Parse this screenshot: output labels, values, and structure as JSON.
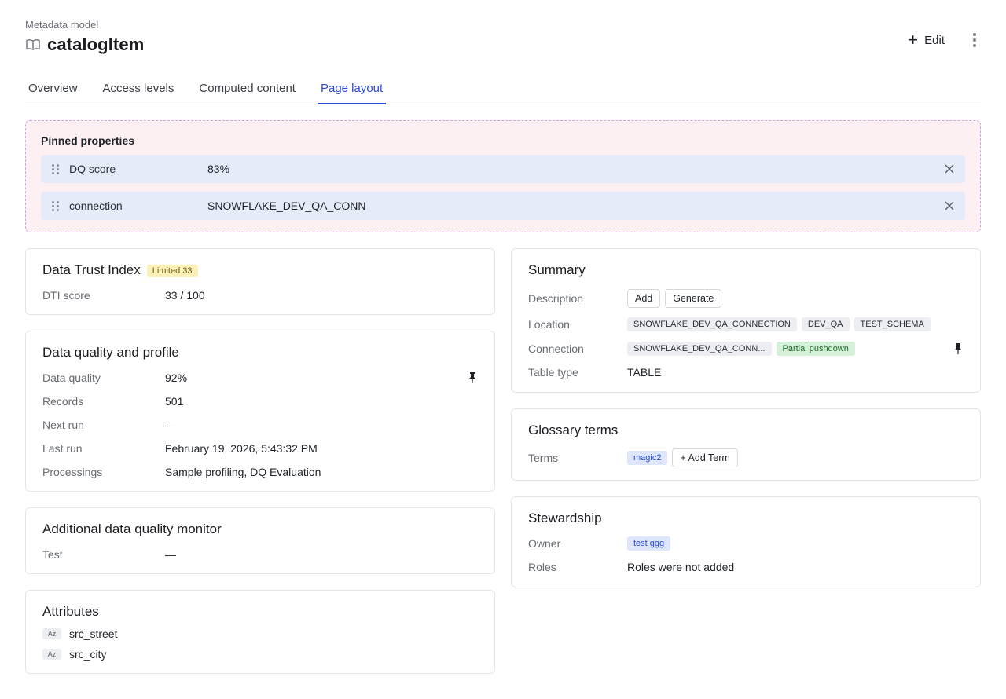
{
  "header": {
    "eyebrow": "Metadata model",
    "title": "catalogItem",
    "edit_label": "Edit"
  },
  "tabs": [
    {
      "label": "Overview"
    },
    {
      "label": "Access levels"
    },
    {
      "label": "Computed content"
    },
    {
      "label": "Page layout",
      "active": true
    }
  ],
  "pinned": {
    "title": "Pinned properties",
    "items": [
      {
        "key": "DQ score",
        "value": "83%"
      },
      {
        "key": "connection",
        "value": "SNOWFLAKE_DEV_QA_CONN"
      }
    ]
  },
  "dti": {
    "title": "Data Trust Index",
    "badge": "Limited 33",
    "rows": [
      {
        "key": "DTI score",
        "value": "33 / 100"
      }
    ]
  },
  "dq": {
    "title": "Data quality and profile",
    "rows": [
      {
        "key": "Data quality",
        "value": "92%"
      },
      {
        "key": "Records",
        "value": "501"
      },
      {
        "key": "Next run",
        "value": "—"
      },
      {
        "key": "Last run",
        "value": "February 19, 2026, 5:43:32 PM"
      },
      {
        "key": "Processings",
        "value": "Sample profiling, DQ Evaluation"
      }
    ]
  },
  "monitor": {
    "title": "Additional data quality monitor",
    "rows": [
      {
        "key": "Test",
        "value": "—"
      }
    ]
  },
  "attributes": {
    "title": "Attributes",
    "type_label": "Az",
    "items": [
      "src_street",
      "src_city"
    ]
  },
  "summary": {
    "title": "Summary",
    "description_label": "Description",
    "add_label": "Add",
    "generate_label": "Generate",
    "location_label": "Location",
    "location_chips": [
      "SNOWFLAKE_DEV_QA_CONNECTION",
      "DEV_QA",
      "TEST_SCHEMA"
    ],
    "connection_label": "Connection",
    "connection_chip": "SNOWFLAKE_DEV_QA_CONN...",
    "pushdown_chip": "Partial pushdown",
    "table_type_label": "Table type",
    "table_type_value": "TABLE"
  },
  "glossary": {
    "title": "Glossary terms",
    "terms_label": "Terms",
    "term_chip": "magic2",
    "add_term_label": "+ Add Term"
  },
  "stewardship": {
    "title": "Stewardship",
    "owner_label": "Owner",
    "owner_chip": "test ggg",
    "roles_label": "Roles",
    "roles_value": "Roles were not added"
  },
  "colors": {
    "accent": "#2a4bd7",
    "pinned_bg": "#fdf0f3",
    "pinned_row_bg": "#e6ebfa",
    "limited_badge_bg": "#fbf1b8",
    "pushdown_chip_bg": "#d6f1d9"
  },
  "icons": {
    "title_icon": "book-open-icon",
    "edit_icon": "plus-icon",
    "menu_icon": "kebab-vertical-icon",
    "drag_icon": "drag-handle-icon",
    "remove_icon": "close-icon",
    "pin_icon": "pin-icon"
  }
}
